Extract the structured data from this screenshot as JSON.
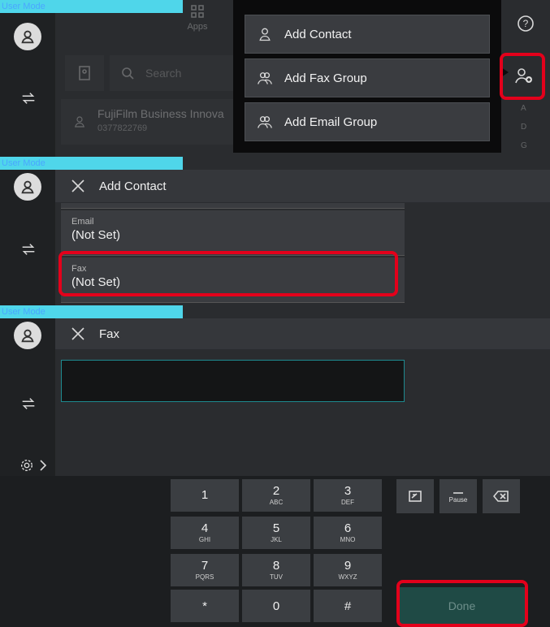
{
  "panel1": {
    "mode": "User Mode",
    "apps_label": "Apps",
    "search_placeholder": "Search",
    "contact_name": "FujiFilm Business Innova",
    "contact_number": "0377822769",
    "menu": [
      "Add Contact",
      "Add Fax Group",
      "Add Email Group"
    ],
    "index_letters": [
      "A",
      "D",
      "G"
    ]
  },
  "panel2": {
    "mode": "User Mode",
    "header_title": "Add Contact",
    "email_label": "Email",
    "email_value": "(Not Set)",
    "fax_label": "Fax",
    "fax_value": "(Not Set)"
  },
  "panel3": {
    "mode": "User Mode",
    "header_title": "Fax",
    "input_value": "",
    "keys": [
      {
        "n": "1",
        "s": ""
      },
      {
        "n": "2",
        "s": "ABC"
      },
      {
        "n": "3",
        "s": "DEF"
      },
      {
        "n": "4",
        "s": "GHI"
      },
      {
        "n": "5",
        "s": "JKL"
      },
      {
        "n": "6",
        "s": "MNO"
      },
      {
        "n": "7",
        "s": "PQRS"
      },
      {
        "n": "8",
        "s": "TUV"
      },
      {
        "n": "9",
        "s": "WXYZ"
      },
      {
        "n": "*",
        "s": ""
      },
      {
        "n": "0",
        "s": ""
      },
      {
        "n": "#",
        "s": ""
      }
    ],
    "pause_label": "Pause",
    "done_label": "Done"
  },
  "colors": {
    "highlight": "#e3001b",
    "mode_bar": "#4fd6ea",
    "done_bg": "#1f4a45"
  }
}
